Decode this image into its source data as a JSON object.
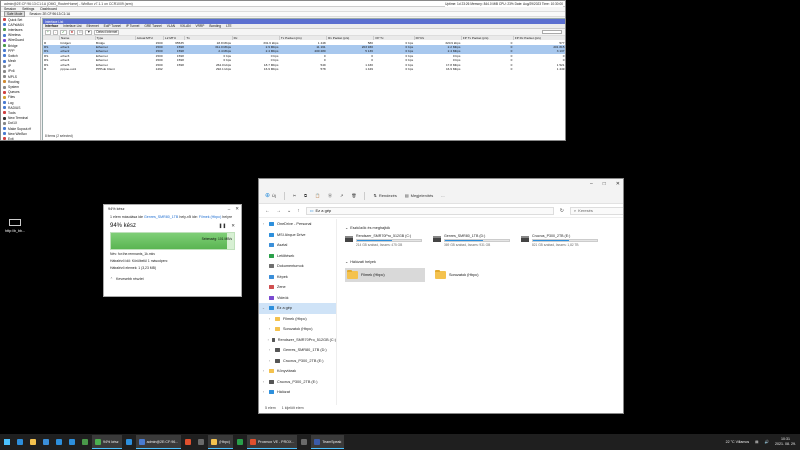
{
  "winbox": {
    "title": "admin@2E:CF:96:13:C1:1A (OMG_RouterHome) - WinBox v7.1.1 on CCR1009 (arm)",
    "menu": [
      "Session",
      "Settings",
      "Dashboard"
    ],
    "safe_mode": "Safe Mode",
    "session_label": "Session: 2E:CF:96:13:C1:1A",
    "top_right": "Uptime: 1d 23:26  Memory: 844.0 MiB  CPU: 23%  Date: Aug/29/2023  Time: 10:30:00",
    "sidebar": [
      {
        "label": "Quick Set",
        "color": "#d04040"
      },
      {
        "label": "CAPsMAN",
        "color": "#4a7bd0"
      },
      {
        "label": "Interfaces",
        "color": "#4a9a4a"
      },
      {
        "label": "Wireless",
        "color": "#4a7bd0"
      },
      {
        "label": "WireGuard",
        "color": "#7a4ad0"
      },
      {
        "label": "Bridge",
        "color": "#4a9a4a"
      },
      {
        "label": "PPP",
        "color": "#4a7bd0"
      },
      {
        "label": "Switch",
        "color": "#4a7bd0"
      },
      {
        "label": "Mesh",
        "color": "#4a7bd0"
      },
      {
        "label": "IP",
        "color": "#888888"
      },
      {
        "label": "IPv6",
        "color": "#888888"
      },
      {
        "label": "MPLS",
        "color": "#888888"
      },
      {
        "label": "Routing",
        "color": "#d08a30"
      },
      {
        "label": "System",
        "color": "#888888"
      },
      {
        "label": "Queues",
        "color": "#d04040"
      },
      {
        "label": "Files",
        "color": "#d0a030"
      },
      {
        "label": "Log",
        "color": "#4a7bd0"
      },
      {
        "label": "RADIUS",
        "color": "#4a7bd0"
      },
      {
        "label": "Tools",
        "color": "#d04040"
      },
      {
        "label": "New Terminal",
        "color": "#333333"
      },
      {
        "label": "Dot1X",
        "color": "#888888"
      },
      {
        "label": "Make Supout.rif",
        "color": "#4a7bd0"
      },
      {
        "label": "New WinBox",
        "color": "#4a7bd0"
      },
      {
        "label": "Exit",
        "color": "#d04040"
      },
      {
        "label": "",
        "color": "#ffffff"
      },
      {
        "label": "Windows",
        "color": "#4a7bd0"
      }
    ],
    "iface_window": {
      "title": "Interface List",
      "tabs": [
        "Interface",
        "Interface List",
        "Ethernet",
        "EoIP Tunnel",
        "IP Tunnel",
        "GRE Tunnel",
        "VLAN",
        "VXLAN",
        "VRRP",
        "Bonding",
        "LTE"
      ],
      "toolbar": [
        "+",
        "-",
        "✔",
        "✖",
        "□",
        "▼",
        "Detect Internet"
      ],
      "columns": [
        "",
        "Name",
        "Type",
        "Actual MTU",
        "L2 MTU",
        "Tx",
        "Rx",
        "Tx Packet (p/s)",
        "Rx Packet (p/s)",
        "FP Tx",
        "FP Rx",
        "FP Tx Packet (p/s)",
        "FP Rx Packet (p/s)"
      ],
      "rows": [
        {
          "flag": "R",
          "name": "bridge1",
          "type": "Bridge",
          "mtu": "1500",
          "l2": "65535",
          "tx": "18.8 Mbps",
          "rx": "331.6 kbps",
          "txp": "1 448",
          "rxp": "580",
          "fptx": "0 bps",
          "fprx": "320.9 kbps",
          "fptxp": "0",
          "fprxp": "577",
          "sel": false
        },
        {
          "flag": "RS",
          "name": "ether1",
          "type": "Ethernet",
          "mtu": "1500",
          "l2": "1598",
          "tx": "311.0 Mbps",
          "rx": "2.9 Mbps",
          "txp": "11 161",
          "rxp": "203 930",
          "fptx": "0 bps",
          "fprx": "2.2 Mbps",
          "fptxp": "0",
          "fprxp": "201 815",
          "sel": true
        },
        {
          "flag": "RS",
          "name": "ether2",
          "type": "Ethernet",
          "mtu": "1500",
          "l2": "1598",
          "tx": "2.4 Mbps",
          "rx": "2.4 Mbps",
          "txp": "200 280",
          "rxp": "5 136",
          "fptx": "0 bps",
          "fprx": "2.4 Mbps",
          "fptxp": "0",
          "fprxp": "3 137",
          "sel": true
        },
        {
          "flag": "RS",
          "name": "ether3",
          "type": "Ethernet",
          "mtu": "1500",
          "l2": "1598",
          "tx": "0 bps",
          "rx": "0 bps",
          "txp": "0",
          "rxp": "0",
          "fptx": "0 bps",
          "fprx": "0 bps",
          "fptxp": "0",
          "fprxp": "0",
          "sel": false
        },
        {
          "flag": "RS",
          "name": "ether4",
          "type": "Ethernet",
          "mtu": "1500",
          "l2": "1598",
          "tx": "0 bps",
          "rx": "0 bps",
          "txp": "0",
          "rxp": "0",
          "fptx": "0 bps",
          "fprx": "0 bps",
          "fptxp": "0",
          "fprxp": "0",
          "sel": false
        },
        {
          "flag": "RS",
          "name": "ether5",
          "type": "Ethernet",
          "mtu": "1500",
          "l2": "1598",
          "tx": "264.0 kbps",
          "rx": "18.7 Mbps",
          "txp": "549",
          "rxp": "1 430",
          "fptx": "0 bps",
          "fprx": "17.8 Mbps",
          "fptxp": "0",
          "fprxp": "1 521",
          "sel": false
        },
        {
          "flag": "R",
          "name": "pppoe-out1",
          "type": "PPPoE Client",
          "mtu": "1492",
          "l2": "",
          "tx": "292.1 kbps",
          "rx": "16.9 Mbps",
          "txp": "578",
          "rxp": "1 449",
          "fptx": "0 bps",
          "fprx": "16.9 Mbps",
          "fptxp": "0",
          "fprxp": "1 449",
          "sel": false
        }
      ],
      "footer": "8 items (2 selected)"
    }
  },
  "desktop_icon": {
    "label": "http:\\\\b_bb..."
  },
  "copy_dialog": {
    "title": "94% kész",
    "line1_prefix": "1 elem másolása ide",
    "line1_src": "Genres_SMR80_1TB",
    "line1_mid": "hely-ről ide:",
    "line1_dst": "Filmek (Hbpc)",
    "line1_suffix": "helyre",
    "percent_text": "94% kész",
    "percent": 0.94,
    "speed": "Sebesség: 101 MB/s",
    "name": "Név: for.the.remnants_1k.mkv",
    "remaining": "Hátralévő idő: Körülbelül 1 másodperc",
    "items": "Hátralévő elemek: 1 (3,23 MB)",
    "less": "Kevesebb részlet"
  },
  "explorer": {
    "commands": [
      "Új",
      "Kivágás",
      "Másolás",
      "Beillesztés",
      "Átnevezés",
      "Megosztás",
      "Törlés",
      "Rendezés",
      "Megjelenítés",
      "..."
    ],
    "address": "Ez a gép",
    "search_placeholder": "Keresés",
    "nav": [
      {
        "label": "OneDrive - Personal",
        "color": "#2d8fdc",
        "chev": "›",
        "sel": false
      },
      {
        "label": "MSI Airque Drive",
        "color": "#2d8fdc",
        "chev": "",
        "sel": false
      },
      {
        "label": "Asztal",
        "color": "#3b8fd9",
        "chev": "",
        "sel": false
      },
      {
        "label": "Letöltések",
        "color": "#2aa04a",
        "chev": "",
        "sel": false
      },
      {
        "label": "Dokumentumok",
        "color": "#6f6f6f",
        "chev": "",
        "sel": false
      },
      {
        "label": "Képek",
        "color": "#3b8fd9",
        "chev": "",
        "sel": false
      },
      {
        "label": "Zene",
        "color": "#d05050",
        "chev": "",
        "sel": false
      },
      {
        "label": "Videók",
        "color": "#7a4ad0",
        "chev": "",
        "sel": false
      },
      {
        "label": "Ez a gép",
        "color": "#2d8fdc",
        "chev": "⌄",
        "sel": true
      },
      {
        "label": "Filmek (Hbpc)",
        "color": "#f4c24e",
        "chev": "›",
        "sel": false
      },
      {
        "label": "Sorozatok (Hbpc)",
        "color": "#f4c24e",
        "chev": "›",
        "sel": false
      },
      {
        "label": "Rendszer_SMR70Pro_512GB (C:)",
        "color": "#555555",
        "chev": "›",
        "sel": false
      },
      {
        "label": "Genres_SMR80_1TB (D:)",
        "color": "#555555",
        "chev": "›",
        "sel": false
      },
      {
        "label": "Crucrus_P300_2TB (E:)",
        "color": "#555555",
        "chev": "›",
        "sel": false
      },
      {
        "label": "Könyvtárak",
        "color": "#f4c24e",
        "chev": "›",
        "sel": false
      },
      {
        "label": "Crucrus_P300_2TB (E:)",
        "color": "#555555",
        "chev": "›",
        "sel": false
      },
      {
        "label": "Hálózat",
        "color": "#2d8fdc",
        "chev": "›",
        "sel": false
      }
    ],
    "section_drives": "Eszközök és meghajtók",
    "drives": [
      {
        "name": "Rendszer_SMR70Pro_512GB (C:)",
        "free": "214 GB szabad, összes: 475 GB",
        "used": 0.55
      },
      {
        "name": "Genres_SMR80_1TB (D:)",
        "free": "369 GB szabad, összes: 931 GB",
        "used": 0.6
      },
      {
        "name": "Crucrus_P300_2TB (E:)",
        "free": "821 GB szabad, összes: 1,82 TB",
        "used": 0.56
      }
    ],
    "section_network": "Hálózati helyek",
    "folders": [
      {
        "name": "Filmek (Hbpc)",
        "sel": true
      },
      {
        "name": "Sorozatok (Hbpc)",
        "sel": false
      }
    ],
    "status_items": "5 elem",
    "status_selected": "1 kijelölt elem"
  },
  "taskbar": {
    "items": [
      {
        "label": "",
        "color": "#2d8fdc",
        "active": false
      },
      {
        "label": "",
        "color": "#f4c24e",
        "active": false
      },
      {
        "label": "",
        "color": "#3b8fd9",
        "active": false
      },
      {
        "label": "",
        "color": "#2d8fdc",
        "active": false
      },
      {
        "label": "",
        "color": "#2d8fdc",
        "active": false
      },
      {
        "label": "",
        "color": "#4a9a4a",
        "active": false
      },
      {
        "label": "94% kész",
        "color": "#4caf50",
        "active": true
      },
      {
        "label": "",
        "color": "#2d8fdc",
        "active": false
      },
      {
        "label": "admin@2E:CF:96...",
        "color": "#4a7bd0",
        "active": true
      },
      {
        "label": "",
        "color": "#e0502e",
        "active": false
      },
      {
        "label": "",
        "color": "#6a6a6a",
        "active": false
      },
      {
        "label": "(Hbpc)",
        "color": "#f4c24e",
        "active": true
      },
      {
        "label": "",
        "color": "#2aa04a",
        "active": false
      },
      {
        "label": "Proxmox VE - PROX...",
        "color": "#e0502e",
        "active": true
      },
      {
        "label": "",
        "color": "#6a6a6a",
        "active": false
      },
      {
        "label": "TeamSpeak",
        "color": "#3b5ba9",
        "active": true
      }
    ],
    "weather": "22 °C  Villamos",
    "time": "10:31",
    "date": "2021. 08. 29."
  }
}
